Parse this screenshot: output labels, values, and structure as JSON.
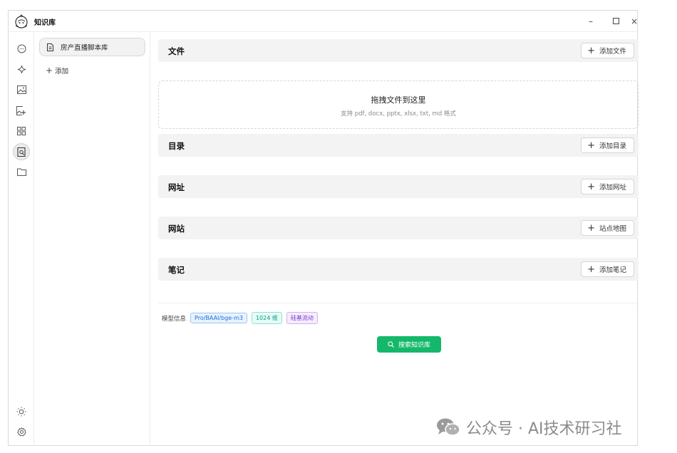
{
  "app": {
    "title": "知识库"
  },
  "window_controls": {
    "minimize": "–",
    "maximize": "□",
    "close": "×"
  },
  "rail": {
    "icons": [
      "chat-icon",
      "sparkle-icon",
      "image-icon",
      "image-edit-icon",
      "apps-grid-icon",
      "knowledge-base-icon",
      "folder-icon",
      "theme-sun-icon",
      "settings-gear-icon"
    ]
  },
  "sidebar": {
    "items": [
      {
        "label": "房产直播脚本库"
      }
    ],
    "add_label": "添加"
  },
  "sections": {
    "files": {
      "title": "文件",
      "button": "添加文件"
    },
    "dropzone": {
      "title": "拖拽文件到这里",
      "subtitle": "支持 pdf, docx, pptx, xlsx, txt, md 格式"
    },
    "directory": {
      "title": "目录",
      "button": "添加目录"
    },
    "url": {
      "title": "网址",
      "button": "添加网址"
    },
    "website": {
      "title": "网站",
      "button": "站点地图"
    },
    "notes": {
      "title": "笔记",
      "button": "添加笔记"
    }
  },
  "model_info": {
    "label": "模型信息",
    "model": "Pro/BAAI/bge-m3",
    "dimensions": "1024 维",
    "provider": "硅基流动"
  },
  "search_button": "搜索知识库",
  "watermark": "公众号 · AI技术研习社",
  "colors": {
    "accent_green": "#15b86a",
    "tag_blue": "#1d6fd8",
    "tag_cyan": "#0f9b84",
    "tag_purple": "#7b3fc8"
  }
}
